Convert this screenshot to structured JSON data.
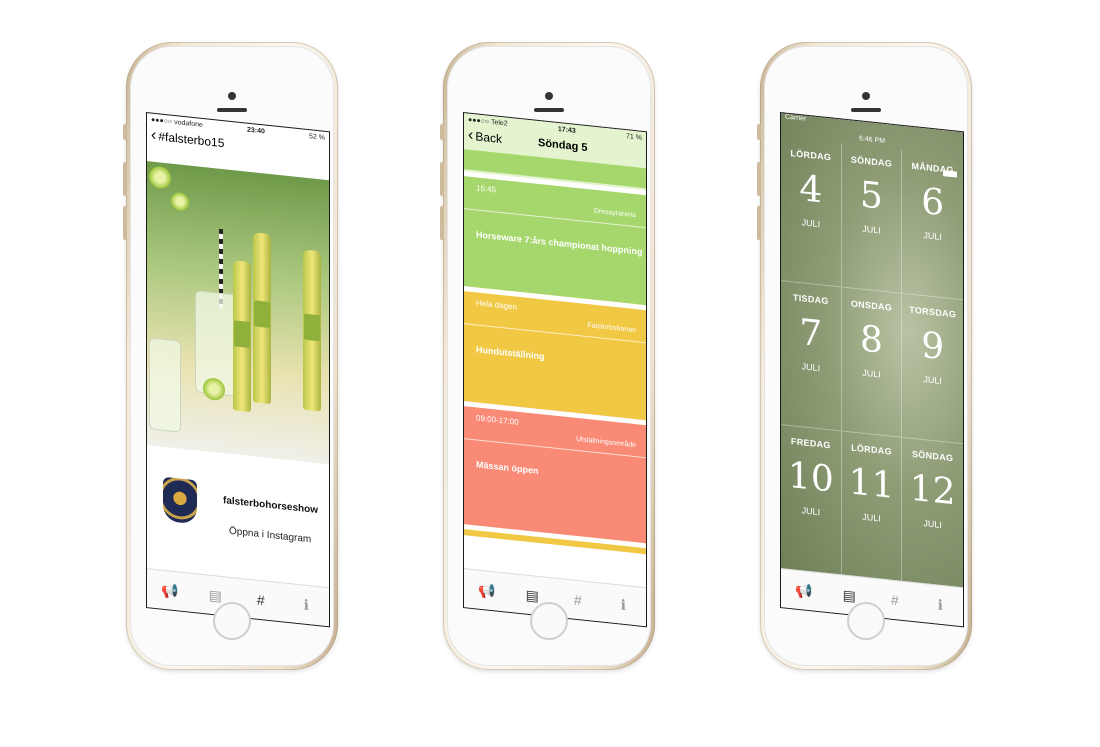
{
  "phones": [
    {
      "status": {
        "carrier": "●●●○○ vodafone",
        "time": "23:40",
        "battery": "52 %"
      },
      "nav_title": "#falsterbo15",
      "profile": {
        "username": "falsterbohorseshow",
        "open_label": "Öppna i Instagram"
      },
      "active_tab": "hashtag"
    },
    {
      "status": {
        "carrier": "●●●○○ Tele2",
        "time": "17:43",
        "battery": "71 %"
      },
      "nav_back": "Back",
      "nav_title": "Söndag 5",
      "events": [
        {
          "time": "15:45",
          "location": "Dressyrarena",
          "title": "Horseware 7:års championat hoppning",
          "color": "#a6d76c"
        },
        {
          "time": "Hela dagen",
          "location": "Falsterbobanan",
          "title": "Hundutställning",
          "color": "#f0c844"
        },
        {
          "time": "09:00-17:00",
          "location": "Utställningsområde",
          "title": "Mässan öppen",
          "color": "#f98a76"
        }
      ],
      "active_tab": "calendar"
    },
    {
      "status": {
        "carrier": "Carrier",
        "time": "6:46 PM"
      },
      "days": [
        {
          "weekday": "LÖRDAG",
          "day": "4",
          "month": "JULI"
        },
        {
          "weekday": "SÖNDAG",
          "day": "5",
          "month": "JULI"
        },
        {
          "weekday": "MÅNDAG",
          "day": "6",
          "month": "JULI"
        },
        {
          "weekday": "TISDAG",
          "day": "7",
          "month": "JULI"
        },
        {
          "weekday": "ONSDAG",
          "day": "8",
          "month": "JULI"
        },
        {
          "weekday": "TORSDAG",
          "day": "9",
          "month": "JULI"
        },
        {
          "weekday": "FREDAG",
          "day": "10",
          "month": "JULI"
        },
        {
          "weekday": "LÖRDAG",
          "day": "11",
          "month": "JULI"
        },
        {
          "weekday": "SÖNDAG",
          "day": "12",
          "month": "JULI"
        }
      ],
      "active_tab": "calendar"
    }
  ],
  "tabs": [
    {
      "name": "megaphone-icon",
      "glyph": "📢"
    },
    {
      "name": "calendar-icon",
      "glyph": "▤"
    },
    {
      "name": "hashtag-icon",
      "glyph": "#"
    },
    {
      "name": "info-icon",
      "glyph": "ℹ"
    }
  ]
}
